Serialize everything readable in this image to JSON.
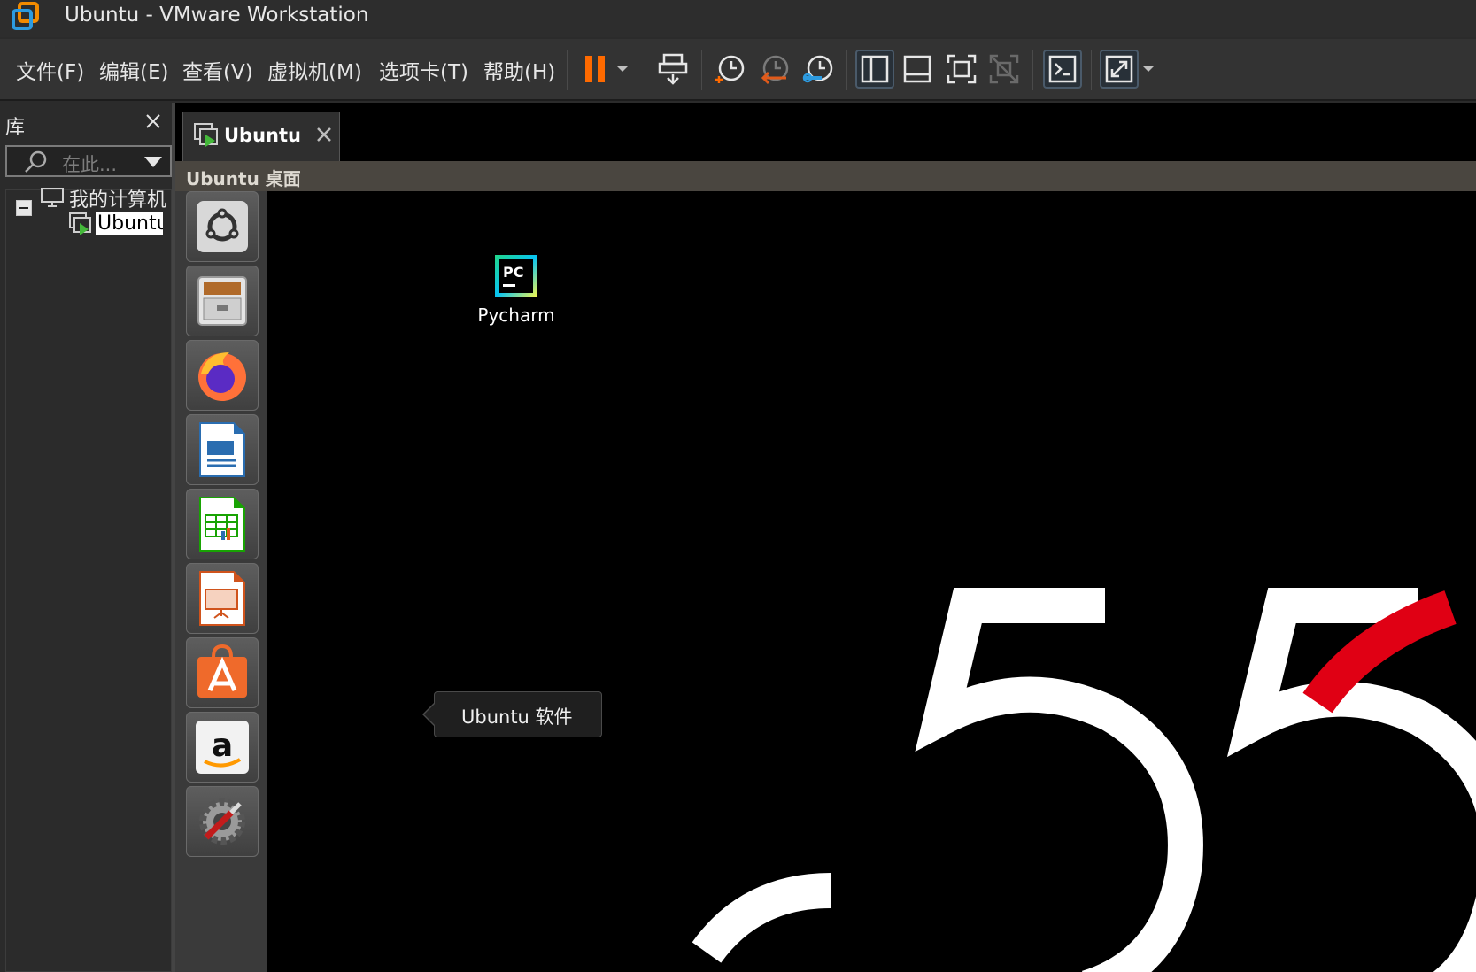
{
  "window": {
    "title": "Ubuntu - VMware Workstation"
  },
  "menu": {
    "items": [
      "文件(F)",
      "编辑(E)",
      "查看(V)",
      "虚拟机(M)",
      "选项卡(T)",
      "帮助(H)"
    ]
  },
  "toolbar": {
    "icons": [
      "pause-icon",
      "dropdown-icon",
      "send-ctrl-alt-del-icon",
      "snapshot-icon",
      "revert-snapshot-icon",
      "snapshot-manager-icon",
      "show-library-icon",
      "show-thumbnail-icon",
      "fullscreen-icon",
      "unity-icon",
      "console-view-icon",
      "stretch-guest-icon"
    ],
    "colors": {
      "pause": "#ff6a00",
      "accent_blue": "#2d9be0",
      "revert": "#e05a1a"
    }
  },
  "library": {
    "title": "库",
    "search_placeholder": "在此...",
    "tree": {
      "root": "我的计算机",
      "child": "Ubuntu"
    }
  },
  "tabs": [
    {
      "label": "Ubuntu"
    }
  ],
  "vm": {
    "header_title": "Ubuntu 桌面",
    "launcher": [
      "dash-home-icon",
      "files-icon",
      "firefox-icon",
      "libreoffice-writer-icon",
      "libreoffice-calc-icon",
      "libreoffice-impress-icon",
      "ubuntu-software-icon",
      "amazon-icon",
      "system-settings-icon"
    ],
    "tooltip": "Ubuntu 软件",
    "desktop_icon": {
      "label": "Pycharm",
      "glyph": "PC"
    },
    "wallpaper": {
      "digits": "55",
      "accent": "#e00014"
    }
  }
}
